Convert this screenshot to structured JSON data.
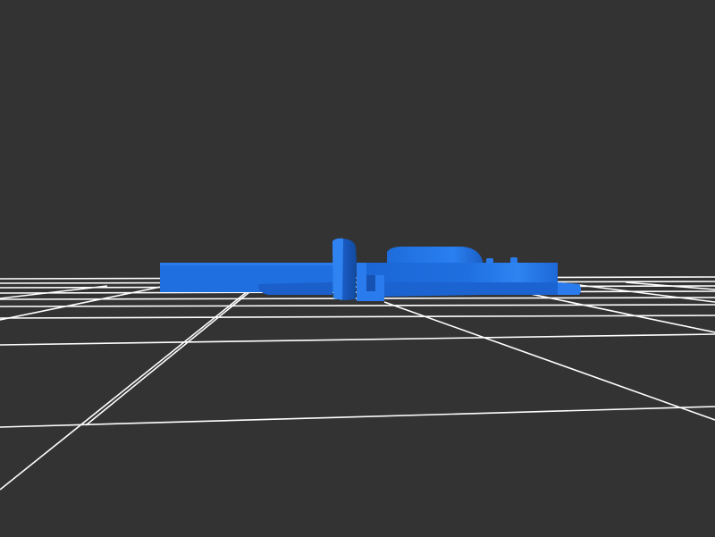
{
  "viewer": {
    "background_color": "#333333",
    "grid_color": "#ffffff",
    "model_color": "#1f6fe0",
    "model_highlight_color": "#3a8cff",
    "model_shadow_color": "#1652b3"
  }
}
